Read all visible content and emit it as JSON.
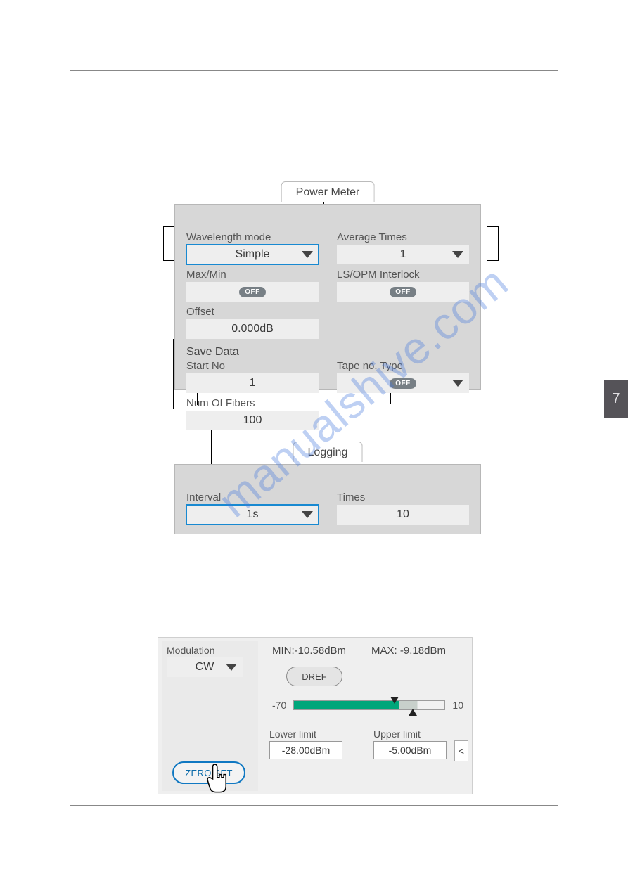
{
  "side_tab": "7",
  "watermark": "manualshive.com",
  "power_meter": {
    "tab": "Power Meter",
    "wavelength_mode": {
      "label": "Wavelength mode",
      "value": "Simple"
    },
    "average_times": {
      "label": "Average Times",
      "value": "1"
    },
    "maxmin": {
      "label": "Max/Min",
      "value": "OFF"
    },
    "interlock": {
      "label": "LS/OPM Interlock",
      "value": "OFF"
    },
    "offset": {
      "label": "Offset",
      "value": "0.000dB"
    },
    "save_data": {
      "title": "Save Data"
    },
    "start_no": {
      "label": "Start No",
      "value": "1"
    },
    "tape_type": {
      "label": "Tape no. Type",
      "value": "OFF"
    },
    "num_fibers": {
      "label": "Num Of Fibers",
      "value": "100"
    }
  },
  "logging": {
    "tab": "Logging",
    "interval": {
      "label": "Interval",
      "value": "1s"
    },
    "times": {
      "label": "Times",
      "value": "10"
    }
  },
  "instrument": {
    "modulation": {
      "label": "Modulation",
      "value": "CW"
    },
    "zero_set": "ZERO SET",
    "min_label": "MIN:",
    "min_value": "-10.58dBm",
    "max_label": "MAX:",
    "max_value": "-9.18dBm",
    "dref": "DREF",
    "gauge_min": "-70",
    "gauge_max": "10",
    "lower_limit": {
      "label": "Lower limit",
      "value": "-28.00dBm"
    },
    "upper_limit": {
      "label": "Upper limit",
      "value": "-5.00dBm"
    },
    "collapse": "<"
  }
}
